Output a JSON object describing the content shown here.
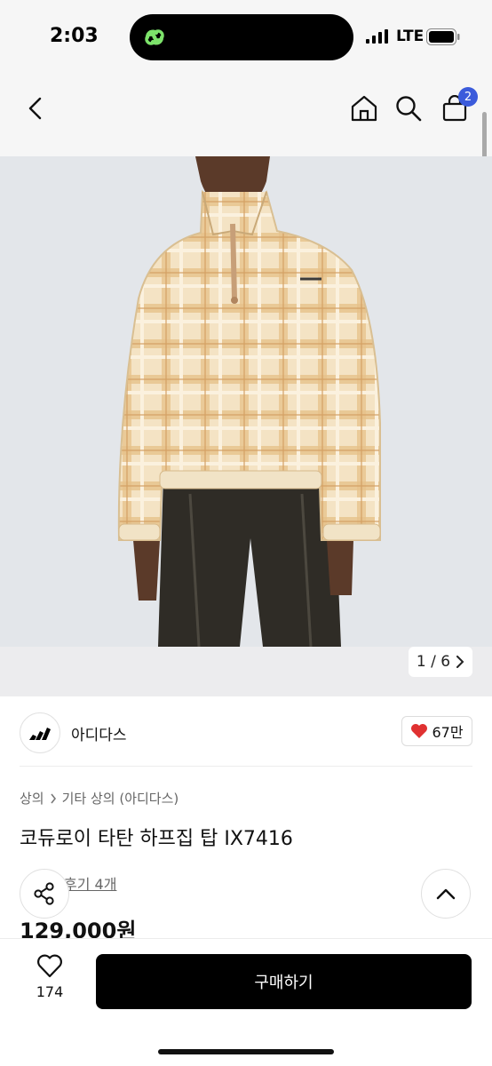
{
  "status": {
    "time": "2:03",
    "carrier": "LTE"
  },
  "nav": {
    "cart_count": "2"
  },
  "image": {
    "counter": "1 / 6"
  },
  "brand": {
    "name": "아디다스",
    "likes": "67만"
  },
  "breadcrumb": {
    "category": "상의",
    "subcategory": "기타 상의 (아디다스)"
  },
  "product": {
    "title": "코듀로이 타탄 하프집 탑 IX7416",
    "review_link": "후기 4개",
    "price": "129,000원"
  },
  "bottom": {
    "wish_count": "174",
    "buy_label": "구매하기"
  },
  "colors": {
    "accent_badge": "#3b5bdb",
    "buy_button": "#000000",
    "heart": "#e03131"
  },
  "icons": [
    "back-icon",
    "home-icon",
    "search-icon",
    "cart-icon",
    "chevron-right-icon",
    "heart-icon",
    "share-icon",
    "chevron-up-icon"
  ]
}
